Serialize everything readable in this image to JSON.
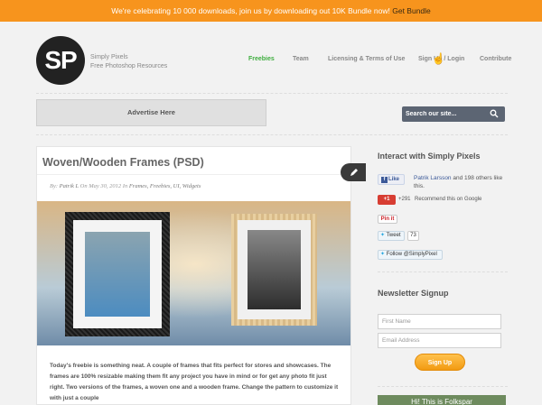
{
  "topbar": {
    "message": "We're celebrating 10 000 downloads, join us by downloading out 10K Bundle now!",
    "cta": "Get Bundle"
  },
  "brand": {
    "logo_text": "SP",
    "name": "Simply Pixels",
    "tagline": "Free Photoshop Resources"
  },
  "nav": {
    "items": [
      {
        "label": "Freebies",
        "active": true
      },
      {
        "label": "Team"
      },
      {
        "label": "Licensing & Terms of Use"
      },
      {
        "label": "Sign Up / Login"
      },
      {
        "label": "Contribute"
      }
    ]
  },
  "advert": {
    "label": "Advertise Here"
  },
  "search": {
    "placeholder": "Search our site...",
    "icon": "search-icon"
  },
  "post": {
    "title": "Woven/Wooden Frames (PSD)",
    "by_prefix": "By:",
    "author": "Patrik L",
    "on": "On May 30, 2012",
    "in": "In",
    "categories": "Frames, Freebies, UI, Widgets",
    "body": "Today's freebie is something neat. A couple of frames that fits perfect for stores and showcases. The frames are 100% resizable making them fit any project you have in mind or for get any photo fit just right. Two versions of the frames, a woven one and a wooden frame. Change the pattern to customize it with just a couple",
    "edit_icon": "pencil-icon"
  },
  "sidebar": {
    "interact_title": "Interact with Simply Pixels",
    "facebook": {
      "button": "Like",
      "name": "Patrik Larsson",
      "text": "and 198 others like this."
    },
    "gplus": {
      "button": "+1",
      "count": "+291",
      "text": "Recommend this on Google"
    },
    "pinterest": {
      "button": "Pin it"
    },
    "twitter": {
      "tweet": "Tweet",
      "count": "73",
      "follow": "Follow @SimplyPixel"
    },
    "newsletter_title": "Newsletter Signup",
    "first_name_placeholder": "First Name",
    "email_placeholder": "Email Address",
    "signup": "Sign Up",
    "promo": "Hi! This is Folkspar"
  },
  "colors": {
    "accent_orange": "#f7941d",
    "nav_active": "#3fae3f",
    "search_bg": "#5c6573"
  }
}
